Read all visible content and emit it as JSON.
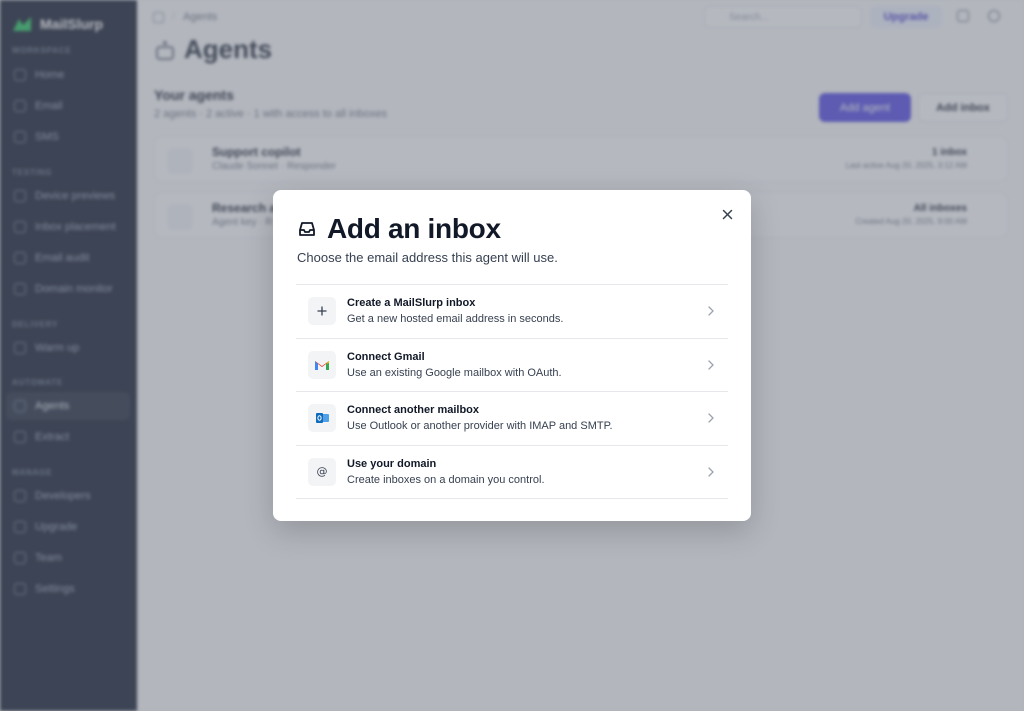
{
  "app": {
    "brand": "MailSlurp"
  },
  "sidebar": {
    "sections": [
      {
        "label": "WORKSPACE",
        "items": [
          {
            "label": "Home"
          },
          {
            "label": "Email"
          },
          {
            "label": "SMS"
          }
        ]
      },
      {
        "label": "TESTING",
        "items": [
          {
            "label": "Device previews"
          },
          {
            "label": "Inbox placement"
          },
          {
            "label": "Email audit"
          },
          {
            "label": "Domain monitor"
          }
        ]
      },
      {
        "label": "DELIVERY",
        "items": [
          {
            "label": "Warm up"
          }
        ]
      },
      {
        "label": "AUTOMATE",
        "items": [
          {
            "label": "Agents",
            "active": true
          },
          {
            "label": "Extract"
          }
        ]
      },
      {
        "label": "MANAGE",
        "items": [
          {
            "label": "Developers"
          },
          {
            "label": "Upgrade"
          },
          {
            "label": "Team"
          },
          {
            "label": "Settings"
          }
        ]
      }
    ]
  },
  "topbar": {
    "breadcrumb": "Agents",
    "search_placeholder": "Search...",
    "upgrade_label": "Upgrade"
  },
  "page": {
    "title": "Agents",
    "section_title": "Your agents",
    "section_sub": "2 agents · 2 active · 1 with access to all inboxes",
    "add_agent_label": "Add agent",
    "add_inbox_label": "Add inbox",
    "agents": [
      {
        "name": "Support copilot",
        "meta": "Claude Sonnet · Responder",
        "right_top": "1 inbox",
        "right_bottom": "Last active Aug 20, 2025, 3:12 AM"
      },
      {
        "name": "Research a",
        "meta": "Agent key · R",
        "right_top": "All inboxes",
        "right_bottom": "Created Aug 20, 2025, 9:00 AM"
      }
    ]
  },
  "modal": {
    "title": "Add an inbox",
    "subtitle": "Choose the email address this agent will use.",
    "options": [
      {
        "title": "Create a MailSlurp inbox",
        "desc": "Get a new hosted email address in seconds.",
        "icon": "plus-icon"
      },
      {
        "title": "Connect Gmail",
        "desc": "Use an existing Google mailbox with OAuth.",
        "icon": "gmail-icon"
      },
      {
        "title": "Connect another mailbox",
        "desc": "Use Outlook or another provider with IMAP and SMTP.",
        "icon": "outlook-icon"
      },
      {
        "title": "Use your domain",
        "desc": "Create inboxes on a domain you control.",
        "icon": "at-sign-icon"
      }
    ]
  },
  "colors": {
    "accent": "#4f46e5",
    "sidebar_bg": "#0f172a"
  }
}
